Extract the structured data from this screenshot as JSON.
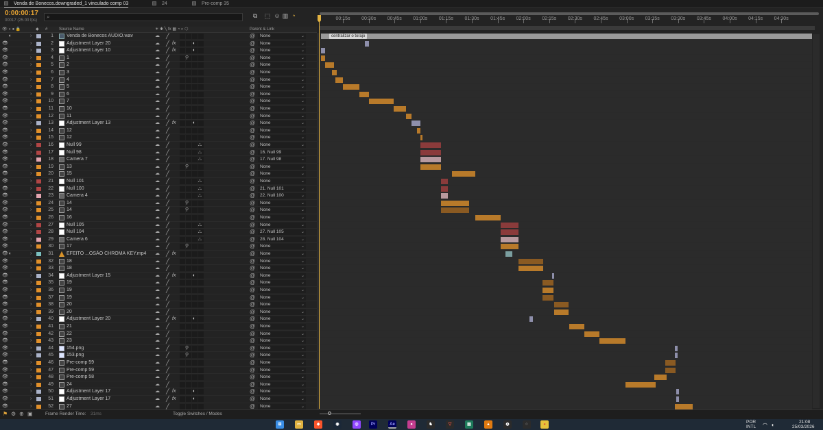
{
  "tabs": [
    {
      "label": "Venda de Bonecos.downgraded_1 vinculado comp 03",
      "active": true
    },
    {
      "label": "24",
      "active": false
    },
    {
      "label": "Pre-comp 35",
      "active": false
    }
  ],
  "timecode": "0:00:00:17",
  "frames": "00017 (25.00 fps)",
  "search": {
    "placeholder": ""
  },
  "columns": {
    "source_name": "Source Name",
    "number": "#",
    "parent_link": "Parent & Link"
  },
  "ruler_labels": [
    "00:15s",
    "00:30s",
    "00:45s",
    "01:00s",
    "01:15s",
    "01:30s",
    "01:45s",
    "02:00s",
    "02:15s",
    "02:30s",
    "02:45s",
    "03:00s",
    "03:15s",
    "03:30s",
    "03:45s",
    "04:00s",
    "04:15s",
    "04:30s"
  ],
  "marker_label": "centralizar o torajo",
  "colors": {
    "accent": "#e3b341",
    "bar_orange": "#b87a2a",
    "bar_purple": "#8e8fab",
    "bar_red": "#8a3b3b",
    "bar_pink": "#b89a9f",
    "bar_teal": "#7b9fa0"
  },
  "layers": [
    {
      "n": "1",
      "name": "Venda de Bonecos AUDIO.wav",
      "type": "aud",
      "label": "#aab2c8",
      "parent": "None",
      "eye": false,
      "audio": true,
      "fx": false,
      "sw": "",
      "bar": [
        6,
        722
      ],
      "bar_color": "#9a9a9a"
    },
    {
      "n": "2",
      "name": "Adjustment Layer 20",
      "type": "solid",
      "label": "#aab2c8",
      "parent": "None",
      "fx": true,
      "sw": "◐",
      "bar": [
        70,
        76
      ],
      "bar_color": "#8e8fab"
    },
    {
      "n": "3",
      "name": "Adjustment Layer 10",
      "type": "solid",
      "label": "#aab2c8",
      "parent": "None",
      "fx": true,
      "sw": "◐",
      "bar": [
        6,
        12
      ],
      "bar_color": "#8e8fab"
    },
    {
      "n": "4",
      "name": "1",
      "type": "precomp",
      "label": "#e08f2a",
      "parent": "None",
      "fx": false,
      "sw": "⚲",
      "bar": [
        6,
        12
      ],
      "bar_color": "#b87a2a"
    },
    {
      "n": "5",
      "name": "2",
      "type": "precomp",
      "label": "#e08f2a",
      "parent": "None",
      "bar": [
        12,
        25
      ],
      "bar_color": "#b87a2a"
    },
    {
      "n": "6",
      "name": "3",
      "type": "precomp",
      "label": "#e08f2a",
      "parent": "None",
      "bar": [
        22,
        29
      ],
      "bar_color": "#b87a2a"
    },
    {
      "n": "7",
      "name": "4",
      "type": "precomp",
      "label": "#e08f2a",
      "parent": "None",
      "bar": [
        27,
        38
      ],
      "bar_color": "#b87a2a"
    },
    {
      "n": "8",
      "name": "5",
      "type": "precomp",
      "label": "#e08f2a",
      "parent": "None",
      "bar": [
        38,
        62
      ],
      "bar_color": "#b87a2a"
    },
    {
      "n": "9",
      "name": "6",
      "type": "precomp",
      "label": "#e08f2a",
      "parent": "None",
      "bar": [
        62,
        76
      ],
      "bar_color": "#b87a2a"
    },
    {
      "n": "10",
      "name": "7",
      "type": "precomp",
      "label": "#e08f2a",
      "parent": "None",
      "bar": [
        76,
        112
      ],
      "bar_color": "#b87a2a"
    },
    {
      "n": "11",
      "name": "10",
      "type": "precomp",
      "label": "#e08f2a",
      "parent": "None",
      "bar": [
        112,
        130
      ],
      "bar_color": "#b87a2a"
    },
    {
      "n": "12",
      "name": "11",
      "type": "precomp",
      "label": "#e08f2a",
      "parent": "None",
      "bar": [
        130,
        138
      ],
      "bar_color": "#b87a2a"
    },
    {
      "n": "13",
      "name": "Adjustment Layer 13",
      "type": "solid",
      "label": "#aab2c8",
      "parent": "None",
      "fx": true,
      "sw": "◐",
      "bar": [
        138,
        151
      ],
      "bar_color": "#8e8fab"
    },
    {
      "n": "14",
      "name": "12",
      "type": "precomp",
      "label": "#e08f2a",
      "parent": "None",
      "bar": [
        146,
        151
      ],
      "bar_color": "#b87a2a"
    },
    {
      "n": "15",
      "name": "12",
      "type": "precomp",
      "label": "#e08f2a",
      "parent": "None",
      "bar": [
        151,
        154
      ],
      "bar_color": "#b87a2a"
    },
    {
      "n": "16",
      "name": "Null 99",
      "type": "null",
      "label": "#b04545",
      "parent": "None",
      "null": true,
      "bar": [
        151,
        181
      ],
      "bar_color": "#8a3b3b"
    },
    {
      "n": "17",
      "name": "Null 98",
      "type": "null",
      "label": "#b04545",
      "parent": "16. Null 99",
      "null": true,
      "bar": [
        151,
        181
      ],
      "bar_color": "#8a3b3b"
    },
    {
      "n": "18",
      "name": "Camera 7",
      "type": "cam",
      "label": "#e3a6b0",
      "parent": "17. Null 98",
      "null": true,
      "bar": [
        151,
        181
      ],
      "bar_color": "#b89a9f"
    },
    {
      "n": "19",
      "name": "13",
      "type": "precomp",
      "label": "#e08f2a",
      "parent": "None",
      "sw": "⚲",
      "bar": [
        151,
        181
      ],
      "bar_color": "#b87a2a"
    },
    {
      "n": "20",
      "name": "15",
      "type": "precomp",
      "label": "#e08f2a",
      "parent": "None",
      "bar": [
        197,
        231
      ],
      "bar_color": "#b87a2a"
    },
    {
      "n": "21",
      "name": "Null 101",
      "type": "null",
      "label": "#b04545",
      "parent": "None",
      "null": true,
      "bar": [
        181,
        191
      ],
      "bar_color": "#8a3b3b"
    },
    {
      "n": "22",
      "name": "Null 100",
      "type": "null",
      "label": "#b04545",
      "parent": "21. Null 101",
      "null": true,
      "bar": [
        181,
        191
      ],
      "bar_color": "#8a3b3b"
    },
    {
      "n": "23",
      "name": "Camera 4",
      "type": "cam",
      "label": "#e3a6b0",
      "parent": "22. Null 100",
      "null": true,
      "bar": [
        181,
        191
      ],
      "bar_color": "#b89a9f"
    },
    {
      "n": "24",
      "name": "14",
      "type": "precomp",
      "label": "#e08f2a",
      "parent": "None",
      "sw": "⚲",
      "bar": [
        181,
        222
      ],
      "bar_color": "#b87a2a"
    },
    {
      "n": "25",
      "name": "14",
      "type": "precomp",
      "label": "#e08f2a",
      "parent": "None",
      "sw": "⚲",
      "bar": [
        181,
        222
      ],
      "bar_color": "#8a5a22"
    },
    {
      "n": "26",
      "name": "16",
      "type": "precomp",
      "label": "#e08f2a",
      "parent": "None",
      "bar": [
        231,
        268
      ],
      "bar_color": "#b87a2a"
    },
    {
      "n": "27",
      "name": "Null 105",
      "type": "null",
      "label": "#b04545",
      "parent": "None",
      "null": true,
      "bar": [
        268,
        294
      ],
      "bar_color": "#8a3b3b"
    },
    {
      "n": "28",
      "name": "Null 104",
      "type": "null",
      "label": "#b04545",
      "parent": "27. Null 105",
      "null": true,
      "bar": [
        268,
        294
      ],
      "bar_color": "#8a3b3b"
    },
    {
      "n": "29",
      "name": "Camera 6",
      "type": "cam",
      "label": "#e3a6b0",
      "parent": "28. Null 104",
      "null": true,
      "bar": [
        268,
        294
      ],
      "bar_color": "#b89a9f"
    },
    {
      "n": "30",
      "name": "17",
      "type": "precomp",
      "label": "#e08f2a",
      "parent": "None",
      "sw": "⚲",
      "bar": [
        268,
        294
      ],
      "bar_color": "#b87a2a"
    },
    {
      "n": "31",
      "name": "EFEITO ...OSÃO CHROMA KEY.mp4",
      "type": "mp4",
      "label": "#7bc0c0",
      "parent": "None",
      "audio": true,
      "fx": true,
      "bar": [
        275,
        285
      ],
      "bar_color": "#7b9fa0"
    },
    {
      "n": "32",
      "name": "18",
      "type": "precomp",
      "label": "#e08f2a",
      "parent": "None",
      "bar": [
        294,
        330
      ],
      "bar_color": "#8a5a22"
    },
    {
      "n": "33",
      "name": "18",
      "type": "precomp",
      "label": "#e08f2a",
      "parent": "None",
      "bar": [
        294,
        330
      ],
      "bar_color": "#b87a2a"
    },
    {
      "n": "34",
      "name": "Adjustment Layer 15",
      "type": "solid",
      "label": "#aab2c8",
      "parent": "None",
      "fx": true,
      "sw": "◐",
      "bar": [
        343,
        346
      ],
      "bar_color": "#8e8fab"
    },
    {
      "n": "35",
      "name": "19",
      "type": "precomp",
      "label": "#e08f2a",
      "parent": "None",
      "bar": [
        329,
        345
      ],
      "bar_color": "#8a5a22"
    },
    {
      "n": "36",
      "name": "19",
      "type": "precomp",
      "label": "#e08f2a",
      "parent": "None",
      "bar": [
        329,
        345
      ],
      "bar_color": "#b87a2a"
    },
    {
      "n": "37",
      "name": "19",
      "type": "precomp",
      "label": "#e08f2a",
      "parent": "None",
      "bar": [
        329,
        345
      ],
      "bar_color": "#8a5a22"
    },
    {
      "n": "38",
      "name": "20",
      "type": "precomp",
      "label": "#e08f2a",
      "parent": "None",
      "bar": [
        346,
        367
      ],
      "bar_color": "#8a5a22"
    },
    {
      "n": "39",
      "name": "20",
      "type": "precomp",
      "label": "#e08f2a",
      "parent": "None",
      "bar": [
        346,
        367
      ],
      "bar_color": "#b87a2a"
    },
    {
      "n": "40",
      "name": "Adjustment Layer 20",
      "type": "solid",
      "label": "#aab2c8",
      "parent": "None",
      "fx": true,
      "sw": "◐",
      "bar": [
        310,
        315
      ],
      "bar_color": "#8e8fab"
    },
    {
      "n": "41",
      "name": "21",
      "type": "precomp",
      "label": "#e08f2a",
      "parent": "None",
      "bar": [
        368,
        390
      ],
      "bar_color": "#b87a2a"
    },
    {
      "n": "42",
      "name": "22",
      "type": "precomp",
      "label": "#e08f2a",
      "parent": "None",
      "bar": [
        390,
        412
      ],
      "bar_color": "#b87a2a"
    },
    {
      "n": "43",
      "name": "23",
      "type": "precomp",
      "label": "#e08f2a",
      "parent": "None",
      "bar": [
        412,
        450
      ],
      "bar_color": "#b87a2a"
    },
    {
      "n": "44",
      "name": "154.png",
      "type": "png",
      "label": "#aab2c8",
      "parent": "None",
      "sw": "⚲",
      "bar": [
        522,
        526
      ],
      "bar_color": "#8e8fab"
    },
    {
      "n": "45",
      "name": "153.png",
      "type": "png",
      "label": "#aab2c8",
      "parent": "None",
      "sw": "⚲",
      "bar": [
        522,
        526
      ],
      "bar_color": "#8e8fab"
    },
    {
      "n": "46",
      "name": "Pre-comp 59",
      "type": "precomp",
      "label": "#e08f2a",
      "parent": "None",
      "bar": [
        508,
        523
      ],
      "bar_color": "#8a5a22"
    },
    {
      "n": "47",
      "name": "Pre-comp 59",
      "type": "precomp",
      "label": "#e08f2a",
      "parent": "None",
      "bar": [
        508,
        523
      ],
      "bar_color": "#8a5a22"
    },
    {
      "n": "48",
      "name": "Pre-comp 58",
      "type": "precomp",
      "label": "#e08f2a",
      "parent": "None",
      "bar": [
        492,
        510
      ],
      "bar_color": "#b87a2a"
    },
    {
      "n": "49",
      "name": "24",
      "type": "precomp",
      "label": "#e08f2a",
      "parent": "None",
      "bar": [
        450,
        494
      ],
      "bar_color": "#b87a2a"
    },
    {
      "n": "50",
      "name": "Adjustment Layer 17",
      "type": "solid",
      "label": "#aab2c8",
      "parent": "None",
      "fx": true,
      "sw": "◐",
      "bar": [
        524,
        528
      ],
      "bar_color": "#8e8fab"
    },
    {
      "n": "51",
      "name": "Adjustment Layer 17",
      "type": "solid",
      "label": "#aab2c8",
      "parent": "None",
      "fx": true,
      "sw": "◐",
      "bar": [
        524,
        528
      ],
      "bar_color": "#8e8fab"
    },
    {
      "n": "52",
      "name": "27",
      "type": "precomp",
      "label": "#e08f2a",
      "parent": "None",
      "bar": [
        522,
        548
      ],
      "bar_color": "#b87a2a"
    }
  ],
  "bottom": {
    "render_time_label": "Frame Render Time:",
    "render_time_value": "31ms",
    "toggle_label": "Toggle Switches / Modes"
  },
  "taskbar": {
    "lang_top": "POR",
    "lang_bottom": "INTL",
    "time": "21:08",
    "date": "25/03/2026"
  }
}
